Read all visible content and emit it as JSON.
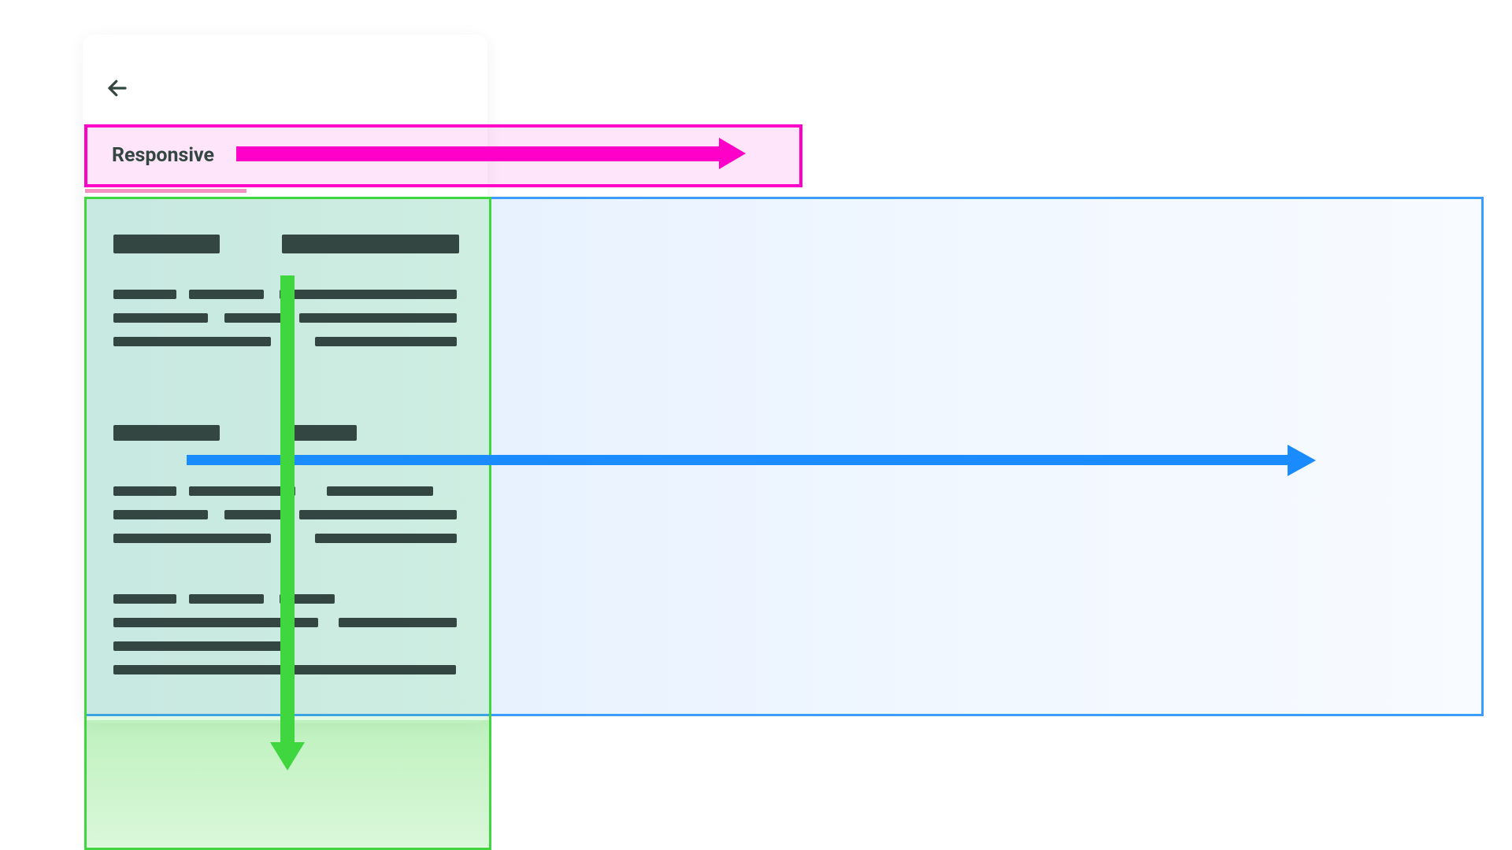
{
  "tabs": {
    "active_label": "Responsive"
  },
  "colors": {
    "pink": "#ff00c8",
    "blue": "#1a8cff",
    "green": "#3fd63f",
    "ink": "#344641"
  },
  "arrows": {
    "pink_direction": "right",
    "blue_direction": "right",
    "green_direction": "down"
  },
  "icons": {
    "back": "arrow-left"
  }
}
